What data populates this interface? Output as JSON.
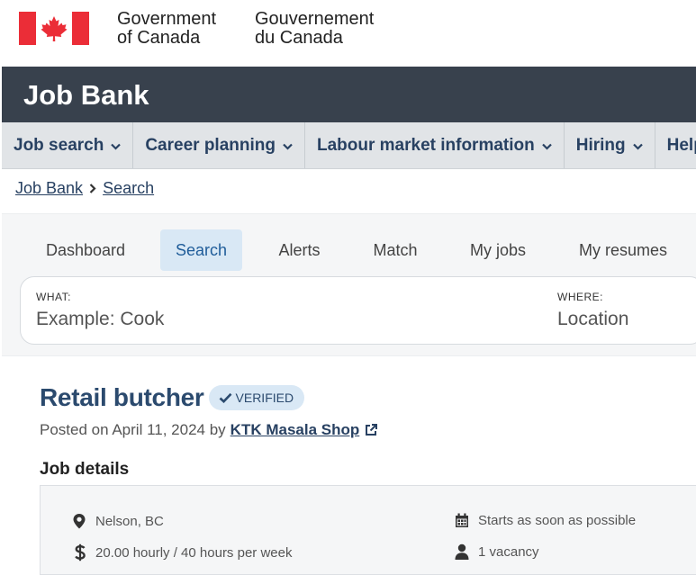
{
  "gov_header": {
    "english_line1": "Government",
    "english_line2": "of Canada",
    "french_line1": "Gouvernement",
    "french_line2": "du Canada",
    "flag_color": "#eb2d37"
  },
  "app": {
    "title": "Job Bank",
    "bar_color": "#38414d"
  },
  "main_nav": {
    "items": [
      {
        "label": "Job search"
      },
      {
        "label": "Career planning"
      },
      {
        "label": "Labour market information"
      },
      {
        "label": "Hiring"
      },
      {
        "label": "Help"
      }
    ]
  },
  "breadcrumb": {
    "items": [
      "Job Bank",
      "Search"
    ]
  },
  "search_tabs": {
    "items": [
      "Dashboard",
      "Search",
      "Alerts",
      "Match",
      "My jobs",
      "My resumes"
    ],
    "active": "Search"
  },
  "search": {
    "what_label": "WHAT:",
    "what_placeholder": "Example: Cook",
    "where_label": "WHERE:",
    "where_placeholder": "Location"
  },
  "job": {
    "title": "Retail butcher",
    "verified_label": "VERIFIED",
    "posted_text": "Posted on April 11, 2024 by",
    "employer": "KTK Masala Shop",
    "details_heading": "Job details",
    "details": {
      "location": "Nelson, BC",
      "salary": "20.00 hourly / 40 hours per week",
      "start": "Starts as soon as possible",
      "vacancies": "1 vacancy"
    }
  },
  "icons": {
    "location": "map-marker-icon",
    "salary": "dollar-icon",
    "start": "calendar-icon",
    "vacancies": "person-icon",
    "external": "external-link-icon",
    "verified": "checkmark-icon"
  }
}
